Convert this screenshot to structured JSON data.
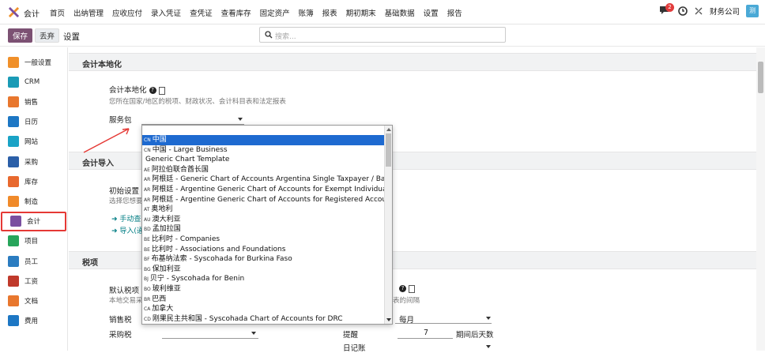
{
  "app": {
    "name": "会计"
  },
  "menu": [
    "首页",
    "出纳管理",
    "应收应付",
    "录入凭证",
    "查凭证",
    "查看库存",
    "固定资产",
    "账簿",
    "报表",
    "期初期末",
    "基础数据",
    "设置",
    "报告"
  ],
  "topbar": {
    "chat_badge": "2",
    "company": "财务公司",
    "avatar": "测"
  },
  "control": {
    "save": "保存",
    "discard": "丢弃",
    "breadcrumb": "设置",
    "search_placeholder": "搜索..."
  },
  "sidebar": [
    {
      "label": "一般设置",
      "icon": "general-settings-icon",
      "color": "#f0902a"
    },
    {
      "label": "CRM",
      "icon": "crm-icon",
      "color": "#1a9bb6"
    },
    {
      "label": "销售",
      "icon": "sales-icon",
      "color": "#e8772e"
    },
    {
      "label": "日历",
      "icon": "calendar-icon",
      "color": "#1d77c4"
    },
    {
      "label": "网站",
      "icon": "website-icon",
      "color": "#1aa3c6"
    },
    {
      "label": "采购",
      "icon": "purchase-icon",
      "color": "#2b5fa8"
    },
    {
      "label": "库存",
      "icon": "inventory-icon",
      "color": "#e8692e"
    },
    {
      "label": "制造",
      "icon": "manufacturing-icon",
      "color": "#f08a2a"
    },
    {
      "label": "会计",
      "icon": "accounting-icon",
      "color": "#7a4fa0"
    },
    {
      "label": "项目",
      "icon": "project-icon",
      "color": "#27a55b"
    },
    {
      "label": "员工",
      "icon": "employees-icon",
      "color": "#2b7cc0"
    },
    {
      "label": "工资",
      "icon": "payroll-icon",
      "color": "#c0392b"
    },
    {
      "label": "文档",
      "icon": "documents-icon",
      "color": "#e8772e"
    },
    {
      "label": "费用",
      "icon": "expenses-icon",
      "color": "#1d77c4"
    }
  ],
  "sections": {
    "localization": {
      "header": "会计本地化",
      "title": "会计本地化",
      "hint": "您所在国家/地区的税项、财政状况、会计科目表和法定报表",
      "package_label": "服务包"
    },
    "import": {
      "header": "会计导入",
      "title": "初始设置",
      "hint": "选择您想要",
      "link_manual": "手动查",
      "link_import": "导入(通"
    },
    "taxes": {
      "header": "税项",
      "default_tax": "默认税项",
      "default_tax_hint": "本地交易采",
      "right_hint": "表的间隔",
      "sales_tax": "销售税",
      "purchase_tax": "采购税",
      "period_value": "每月",
      "remind_label": "提醒",
      "remind_value": "7",
      "remind_suffix": "期间后天数",
      "journal_label": "日记账"
    }
  },
  "dropdown": {
    "items": [
      {
        "code": "CN",
        "label": "中国",
        "selected": true
      },
      {
        "code": "CN",
        "label": "中国 - Large Business"
      },
      {
        "code": "",
        "label": "Generic Chart Template"
      },
      {
        "code": "AE",
        "label": "阿拉伯联合酋长国"
      },
      {
        "code": "AR",
        "label": "阿根廷 - Generic Chart of Accounts Argentina Single Taxpayer / Basis"
      },
      {
        "code": "AR",
        "label": "阿根廷 - Argentine Generic Chart of Accounts for Exempt Individuals"
      },
      {
        "code": "AR",
        "label": "阿根廷 - Argentine Generic Chart of Accounts for Registered Accountants"
      },
      {
        "code": "AT",
        "label": "奥地利"
      },
      {
        "code": "AU",
        "label": "澳大利亚"
      },
      {
        "code": "BD",
        "label": "孟加拉国"
      },
      {
        "code": "BE",
        "label": "比利时 - Companies"
      },
      {
        "code": "BE",
        "label": "比利时 - Associations and Foundations"
      },
      {
        "code": "BF",
        "label": "布基纳法索 - Syscohada for Burkina Faso"
      },
      {
        "code": "BG",
        "label": "保加利亚"
      },
      {
        "code": "BJ",
        "label": "贝宁 - Syscohada for Benin"
      },
      {
        "code": "BO",
        "label": "玻利维亚"
      },
      {
        "code": "BR",
        "label": "巴西"
      },
      {
        "code": "CA",
        "label": "加拿大"
      },
      {
        "code": "CD",
        "label": "刚果民主共和国 - Syscohada Chart of Accounts for DRC"
      }
    ]
  }
}
